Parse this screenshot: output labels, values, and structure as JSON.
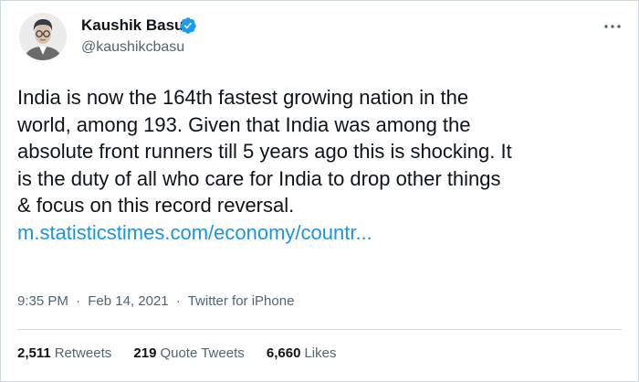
{
  "author": {
    "display_name": "Kaushik Basu",
    "handle": "@kaushikcbasu",
    "verified_icon": "verified-badge-icon",
    "avatar": "avatar-photo"
  },
  "more_icon": "more-options-icon",
  "tweet": {
    "lines": [
      "India is now the 164th fastest growing nation in the",
      "world, among 193. Given that India was among the",
      "absolute front runners till 5 years ago this is shocking. It",
      "is the duty of all who care for India to drop other things",
      "& focus on this record reversal."
    ],
    "link_text": "m.statisticstimes.com/economy/countr..."
  },
  "meta": {
    "time": "9:35 PM",
    "separator": "·",
    "date": "Feb 14, 2021",
    "source": "Twitter for iPhone"
  },
  "stats": {
    "retweets": {
      "count": "2,511",
      "label": "Retweets"
    },
    "quote_tweets": {
      "count": "219",
      "label": "Quote Tweets"
    },
    "likes": {
      "count": "6,660",
      "label": "Likes"
    }
  },
  "colors": {
    "link": "#1b95e0",
    "verified": "#1d9bf0",
    "secondary_text": "#536471",
    "primary_text": "#0f1419",
    "border": "#cfd9de"
  }
}
